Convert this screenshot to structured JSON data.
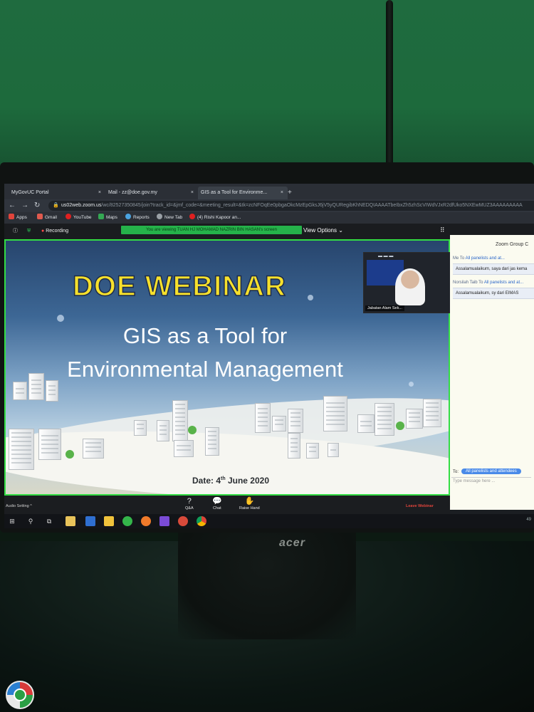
{
  "browser": {
    "tabs": [
      {
        "label": "MyGovUC Portal",
        "close": "×"
      },
      {
        "label": "Mail - zz@doe.gov.my",
        "close": "×"
      },
      {
        "label": "GIS as a Tool for Environme...",
        "close": "×"
      }
    ],
    "new_tab": "+",
    "url_host": "us02web.zoom.us",
    "url_rest": "/wc/82527350845/join?track_id=&jmf_code=&meeting_result=&tk=zcNFOqEe0pbgaOkcMzEpGksJ6jV5yQURegibKhNEDQIAAAATbeIbxZh5zhScVIWdVJxR2dfUko5NXEwMUZ3AAAAAAAAA",
    "bookmarks": [
      {
        "label": "Apps",
        "color": "#e0443b"
      },
      {
        "label": "Gmail",
        "color": "#e05a4e"
      },
      {
        "label": "YouTube",
        "color": "#e02020"
      },
      {
        "label": "Maps",
        "color": "#34a853"
      },
      {
        "label": "Reports",
        "color": "#4aa3e0"
      },
      {
        "label": "New Tab",
        "color": "#9aa0a6"
      },
      {
        "label": "(4) Rishi Kapoor an...",
        "color": "#e02020"
      }
    ]
  },
  "zoom": {
    "recording_label": "Recording",
    "viewing_banner": "You are viewing TUAN HJ MOHAMAD NAZRIN BIN HASAN's screen",
    "view_options": "View Options ⌄",
    "expand": "⠿",
    "video_name": "Jabatan Alam Sek...",
    "controls": [
      {
        "icon": "?",
        "label": "Q&A"
      },
      {
        "icon": "💬",
        "label": "Chat"
      },
      {
        "icon": "✋",
        "label": "Raise Hand"
      }
    ],
    "audio_setting": "Audio Setting  ^",
    "leave": "Leave Webinar"
  },
  "slide": {
    "title": "DOE WEBINAR",
    "subtitle_line1": "GIS as a Tool for",
    "subtitle_line2": "Environmental Management",
    "date_prefix": "Date:  4",
    "date_sup": "th",
    "date_rest": " June 2020"
  },
  "chat": {
    "title": "Zoom Group C",
    "messages": [
      {
        "from": "Me To ",
        "to": "All panelists and at...",
        "text": "Assalamualaikum, saya dari jas kema"
      },
      {
        "from": "Norsilah Taib To ",
        "to": "All panelists and at...",
        "text": "Assalamualaikum, sy dari EIMAS"
      }
    ],
    "to_label": "To:",
    "recipient": "All panelists and attendees",
    "input_placeholder": "Type message here ..."
  },
  "monitor_brand": "acer",
  "taskbar": {
    "tray_text": "49"
  }
}
